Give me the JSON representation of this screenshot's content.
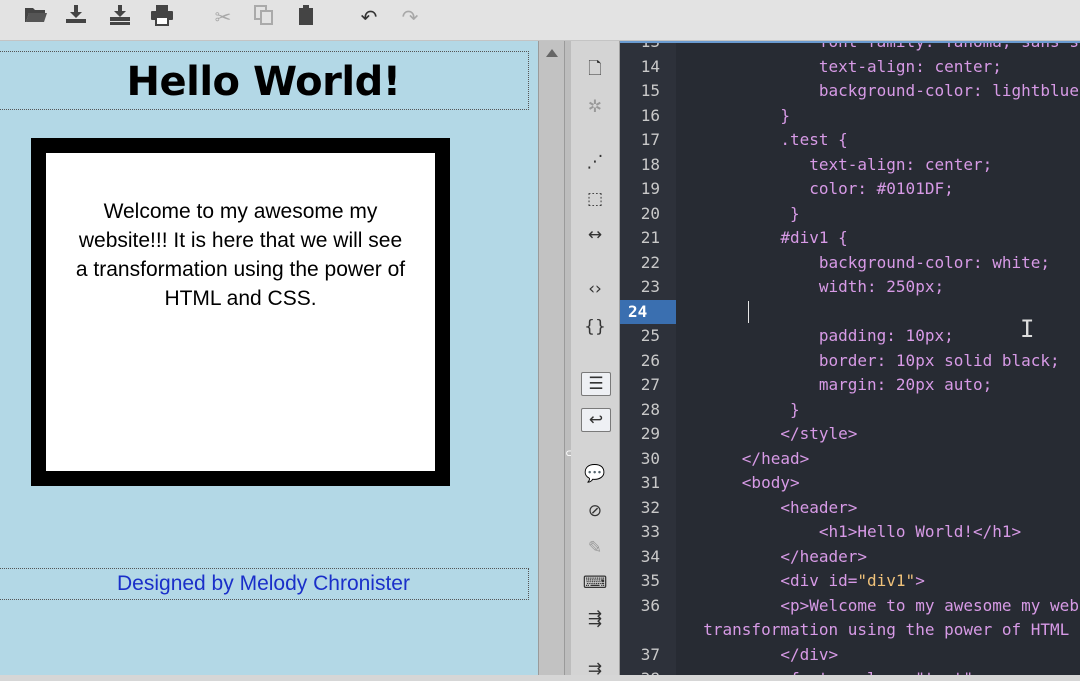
{
  "toolbar": {
    "icons": [
      "folder-open",
      "save",
      "save-all",
      "print",
      "cut",
      "copy",
      "paste",
      "undo",
      "redo"
    ]
  },
  "preview": {
    "heading": "Hello World!",
    "paragraph": "Welcome to my awesome my website!!! It is here that we will see a transformation using the power of HTML and CSS.",
    "footer": "Designed by Melody Chronister"
  },
  "editor": {
    "active_line": "24",
    "lines": [
      {
        "num": "13",
        "text": "              font-family: Tahoma, sans-serif;"
      },
      {
        "num": "14",
        "text": "              text-align: center;"
      },
      {
        "num": "15",
        "text": "              background-color: lightblue;"
      },
      {
        "num": "16",
        "text": "          }"
      },
      {
        "num": "17",
        "text": "          .test {"
      },
      {
        "num": "18",
        "text": "             text-align: center;"
      },
      {
        "num": "19",
        "text": "             color: #0101DF;"
      },
      {
        "num": "20",
        "text": "           }"
      },
      {
        "num": "21",
        "text": "          #div1 {"
      },
      {
        "num": "22",
        "text": "              background-color: white;"
      },
      {
        "num": "23",
        "text": "              width: 250px;"
      },
      {
        "num": "24",
        "text": ""
      },
      {
        "num": "25",
        "text": "              padding: 10px;"
      },
      {
        "num": "26",
        "text": "              border: 10px solid black;"
      },
      {
        "num": "27",
        "text": "              margin: 20px auto;"
      },
      {
        "num": "28",
        "text": "           }"
      },
      {
        "num": "29",
        "text": "          </style>"
      },
      {
        "num": "30",
        "text": "      </head>"
      },
      {
        "num": "31",
        "text": "      <body>"
      },
      {
        "num": "32",
        "text": "          <header>"
      },
      {
        "num": "33",
        "text": "              <h1>Hello World!</h1>"
      },
      {
        "num": "34",
        "text": "          </header>"
      },
      {
        "num": "35",
        "pre": "          <div id=",
        "str": "\"div1\"",
        "post": ">"
      },
      {
        "num": "36",
        "text": "          <p>Welcome to my awesome my website!!! It is here that we will see a"
      },
      {
        "num": "",
        "text": "  transformation using the power of HTML and CSS.</p>"
      },
      {
        "num": "37",
        "text": "          </div>"
      },
      {
        "num": "38",
        "text": "          <footer class=\"test\">"
      }
    ]
  }
}
